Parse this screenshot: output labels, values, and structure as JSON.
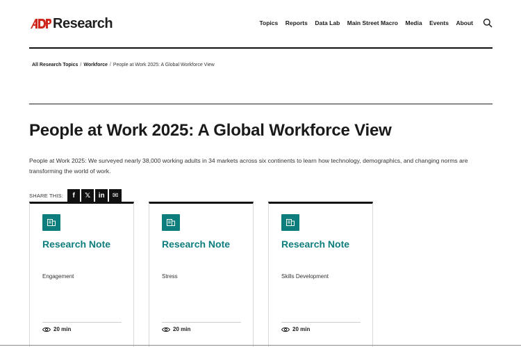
{
  "header": {
    "logo_text": "Research",
    "brand_color": "#d0271d",
    "nav": [
      "Topics",
      "Reports",
      "Data Lab",
      "Main Street Macro",
      "Media",
      "Events",
      "About"
    ],
    "search_icon": "search-icon"
  },
  "breadcrumb": {
    "items": [
      "All Research Topics",
      "Workforce"
    ],
    "current": "People at Work 2025: A Global Workforce View",
    "separator": "/"
  },
  "page": {
    "title": "People at Work 2025: A Global Workforce View",
    "intro": "People at Work 2025: We surveyed nearly 38,000 working adults in 34 markets across six continents to learn how technology, demographics, and changing norms are transforming the world of work."
  },
  "share": {
    "label": "SHARE THIS:",
    "buttons": [
      "f",
      "𝕏",
      "in",
      "✉"
    ],
    "icons": [
      "facebook-icon",
      "x-icon",
      "linkedin-icon",
      "email-icon"
    ]
  },
  "accent_color": "#0e7d7e",
  "cards": [
    {
      "type": "Research Note",
      "topic": "Engagement",
      "read_time": "20 min"
    },
    {
      "type": "Research Note",
      "topic": "Stress",
      "read_time": "20 min"
    },
    {
      "type": "Research Note",
      "topic": "Skills Development",
      "read_time": "20 min"
    }
  ]
}
